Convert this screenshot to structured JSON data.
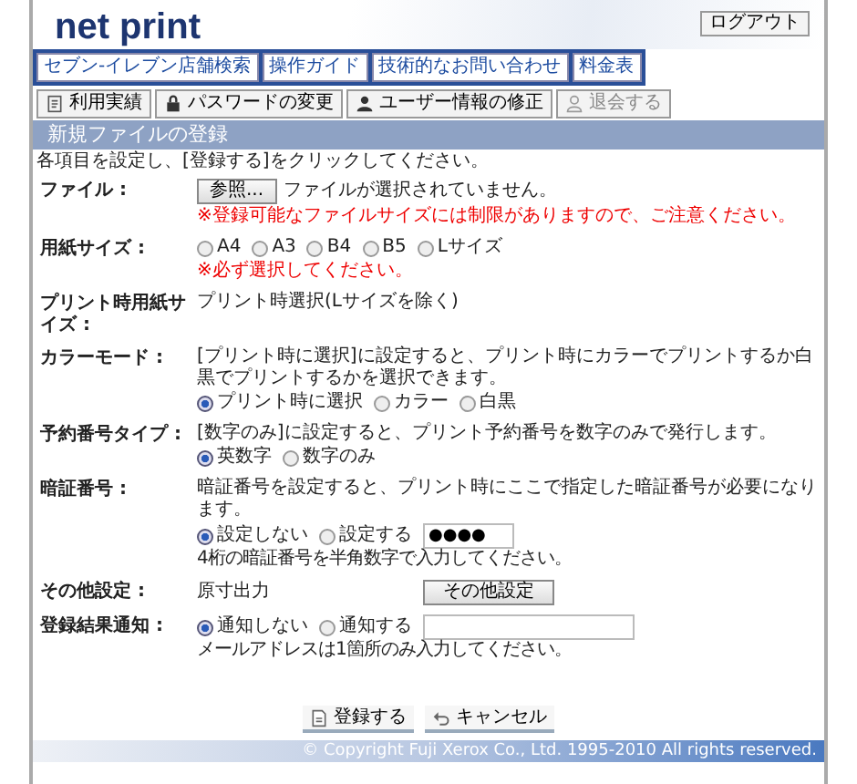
{
  "logo": "net print",
  "logout": "ログアウト",
  "nav_links": [
    "セブン-イレブン店舗検索",
    "操作ガイド",
    "技術的なお問い合わせ",
    "料金表"
  ],
  "nav_buttons": [
    {
      "label": "利用実績",
      "kind": "history"
    },
    {
      "label": "パスワードの変更",
      "kind": "lock"
    },
    {
      "label": "ユーザー情報の修正",
      "kind": "user"
    },
    {
      "label": "退会する",
      "kind": "leave"
    }
  ],
  "page_title": "新規ファイルの登録",
  "instruction": "各項目を設定し、[登録する]をクリックしてください。",
  "fields": [
    {
      "kind": "file",
      "label": "ファイル :",
      "button": "参照...",
      "value": "ファイルが選択されていません。",
      "note": "※登録可能なファイルサイズには制限がありますので、ご注意ください。"
    },
    {
      "kind": "radio",
      "label": "用紙サイズ :",
      "options": [
        {
          "label": "A4",
          "selected": false
        },
        {
          "label": "A3",
          "selected": false
        },
        {
          "label": "B4",
          "selected": false
        },
        {
          "label": "B5",
          "selected": false
        },
        {
          "label": "Lサイズ",
          "selected": false
        }
      ],
      "note": "※必ず選択してください。"
    },
    {
      "kind": "text",
      "label": "プリント時用紙サイズ :",
      "value": "プリント時選択(Lサイズを除く)"
    },
    {
      "kind": "radio",
      "label": "カラーモード :",
      "description": "[プリント時に選択]に設定すると、プリント時にカラーでプリントするか白黒でプリントするかを選択できます。",
      "options": [
        {
          "label": "プリント時に選択",
          "selected": true
        },
        {
          "label": "カラー",
          "selected": false
        },
        {
          "label": "白黒",
          "selected": false
        }
      ]
    },
    {
      "kind": "radio",
      "label": "予約番号タイプ :",
      "description": "[数字のみ]に設定すると、プリント予約番号を数字のみで発行します。",
      "options": [
        {
          "label": "英数字",
          "selected": true
        },
        {
          "label": "数字のみ",
          "selected": false
        }
      ]
    },
    {
      "kind": "radio",
      "label": "暗証番号 :",
      "description": "暗証番号を設定すると、プリント時にここで指定した暗証番号が必要になります。",
      "options": [
        {
          "label": "設定しない",
          "selected": true
        },
        {
          "label": "設定する",
          "selected": false
        }
      ],
      "input": "●●●●",
      "hint": "4桁の暗証番号を半角数字で入力してください。"
    },
    {
      "kind": "text",
      "label": "その他設定 :",
      "value": "原寸出力",
      "button": "その他設定"
    },
    {
      "kind": "radio",
      "label": "登録結果通知 :",
      "options": [
        {
          "label": "通知しない",
          "selected": true
        },
        {
          "label": "通知する",
          "selected": false
        }
      ],
      "input": true,
      "hint": "メールアドレスは1箇所のみ入力してください。"
    }
  ],
  "actions": [
    {
      "label": "登録する",
      "kind": "submit"
    },
    {
      "label": "キャンセル",
      "kind": "cancel"
    }
  ],
  "footer": "© Copyright Fuji Xerox Co., Ltd. 1995-2010 All rights reserved."
}
